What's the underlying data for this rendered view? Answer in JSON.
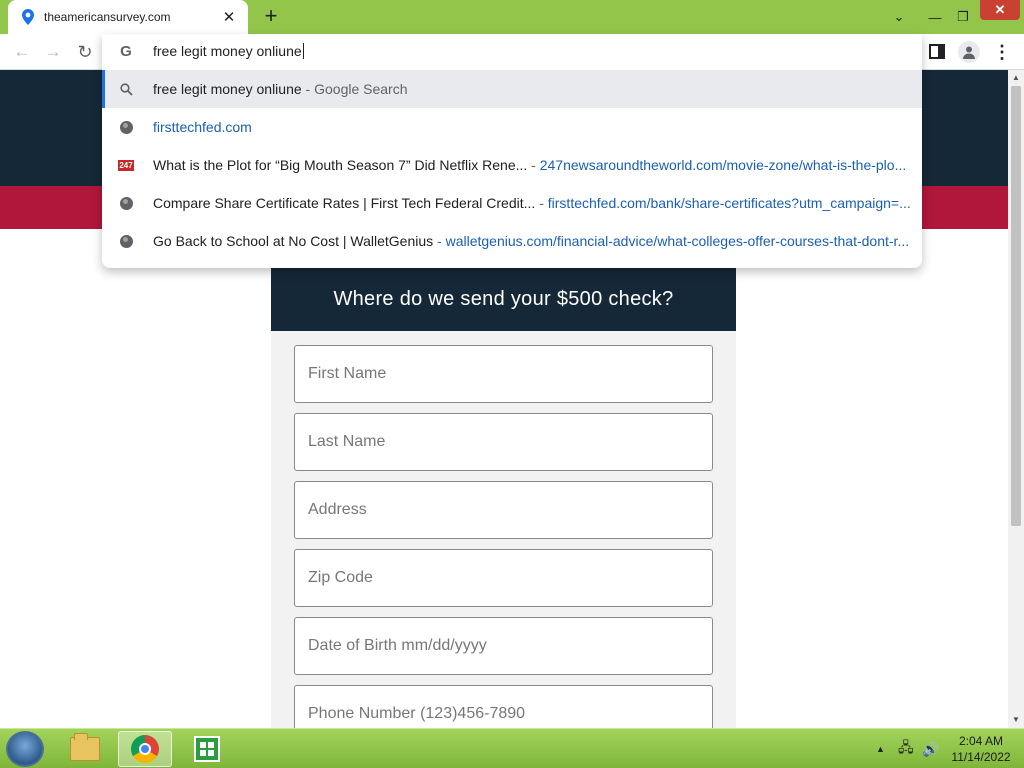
{
  "browser": {
    "tab": {
      "title": "theamericansurvey.com",
      "close_glyph": "✕"
    },
    "new_tab_glyph": "+",
    "window_controls": {
      "tab_search_glyph": "⌄",
      "minimize_glyph": "—",
      "maximize_glyph": "❐",
      "close_glyph": "✕"
    },
    "nav": {
      "back_glyph": "←",
      "forward_glyph": "→",
      "reload_glyph": "↻",
      "menu_glyph": "⋮"
    }
  },
  "omnibox": {
    "input_value": "free legit money onliune",
    "g_glyph": "G",
    "suggestions": [
      {
        "icon": "search-icon",
        "main": "free legit money onliune",
        "sep": " - ",
        "desc": "Google Search",
        "url": ""
      },
      {
        "icon": "globe-icon",
        "main": "",
        "sep": "",
        "desc": "",
        "url": "firsttechfed.com"
      },
      {
        "icon": "site-favicon",
        "favicon_text": "247",
        "main": "What is the Plot for “Big Mouth Season 7” Did Netflix Rene...",
        "sep": " - ",
        "desc": "",
        "url": "247newsaroundtheworld.com/movie-zone/what-is-the-plo..."
      },
      {
        "icon": "globe-icon",
        "main": "Compare Share Certificate Rates | First Tech Federal Credit...",
        "sep": " - ",
        "desc": "",
        "url": "firsttechfed.com/bank/share-certificates?utm_campaign=..."
      },
      {
        "icon": "globe-icon",
        "main": "Go Back to School at No Cost | WalletGenius",
        "sep": " - ",
        "desc": "",
        "url": "walletgenius.com/financial-advice/what-colleges-offer-courses-that-dont-r..."
      }
    ]
  },
  "page": {
    "form": {
      "title": "Where do we send your $500 check?",
      "fields": [
        {
          "placeholder": "First Name"
        },
        {
          "placeholder": "Last Name"
        },
        {
          "placeholder": "Address"
        },
        {
          "placeholder": "Zip Code"
        },
        {
          "placeholder": "Date of Birth mm/dd/yyyy"
        },
        {
          "placeholder": "Phone Number (123)456-7890"
        }
      ]
    },
    "colors": {
      "banner_dark": "#152837",
      "banner_red": "#b0173a",
      "titlebar_green": "#93c54b"
    }
  },
  "scrollbar": {
    "up_glyph": "▲",
    "down_glyph": "▼"
  },
  "taskbar": {
    "tray_arrow_glyph": "▲",
    "network_glyph": "🖧",
    "volume_glyph": "🔊",
    "clock_time": "2:04 AM",
    "clock_date": "11/14/2022"
  }
}
